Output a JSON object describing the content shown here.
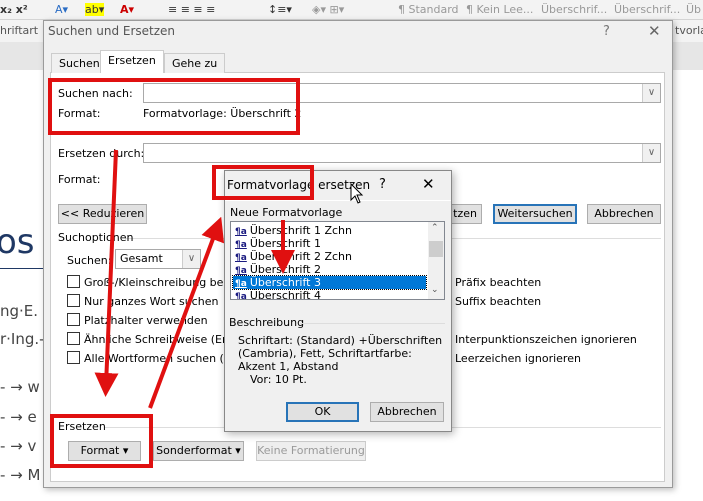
{
  "ribbon": {
    "styles": [
      "¶ Standard",
      "¶ Kein Lee...",
      "Überschrif...",
      "Überschrif...",
      "Üb"
    ],
    "group_left": "hriftart",
    "group_right": "tvorla"
  },
  "document": {
    "heading": "os",
    "lines": [
      "ng·E.",
      "r·Ing.-"
    ],
    "bullets": [
      "- → w",
      "- → e",
      "- → v",
      "- → M"
    ]
  },
  "dialog": {
    "title": "Suchen und Ersetzen",
    "help": "?",
    "close": "✕",
    "tabs": [
      {
        "label": "Suchen"
      },
      {
        "label": "Ersetzen",
        "active": true
      },
      {
        "label": "Gehe zu"
      }
    ],
    "find_label": "Suchen nach:",
    "find_value": "",
    "find_format_label": "Format:",
    "find_format_value": "Formatvorlage: Überschrift 2",
    "replace_label": "Ersetzen durch:",
    "replace_value": "",
    "replace_format_label": "Format:",
    "buttons": {
      "reduce": "<< Reduzieren",
      "replace_all_partial": "tzen",
      "find_next": "Weitersuchen",
      "cancel": "Abbrechen"
    },
    "search_options_label": "Suchoptionen",
    "search_label": "Suchen:",
    "search_value": "Gesamt",
    "options_left": [
      "Groß-/Kleinschreibung beachten",
      "Nur ganzes Wort suchen",
      "Platzhalter verwenden",
      "Ähnliche Schreibweise (Englisch)",
      "Alle Wortformen suchen (Englisch)"
    ],
    "options_right": [
      "Präfix beachten",
      "Suffix beachten",
      "Interpunktionszeichen ignorieren",
      "Leerzeichen ignorieren"
    ],
    "replace_group_label": "Ersetzen",
    "format_button": "Format ▾",
    "special_button": "Sonderformat ▾",
    "no_format_button": "Keine Formatierung"
  },
  "subdialog": {
    "title": "Formatvorlage ersetzen",
    "help": "?",
    "close": "✕",
    "list_label": "Neue Formatvorlage",
    "style_icon": "¶a",
    "items": [
      "Überschrift 1 Zchn",
      "Überschrift 1",
      "Überschrift 2 Zchn",
      "Überschrift 2",
      "Überschrift 3",
      "Überschrift 4"
    ],
    "selected": "Überschrift 3",
    "description_label": "Beschreibung",
    "description": "Schriftart: (Standard) +Überschriften (Cambria), Fett, Schriftartfarbe: Akzent 1, Abstand",
    "description_2": "Vor:  10 Pt.",
    "ok": "OK",
    "cancel": "Abbrechen"
  },
  "colors": {
    "annotation": "#e01010",
    "selection": "#0078d7",
    "heading": "#1f3864"
  }
}
